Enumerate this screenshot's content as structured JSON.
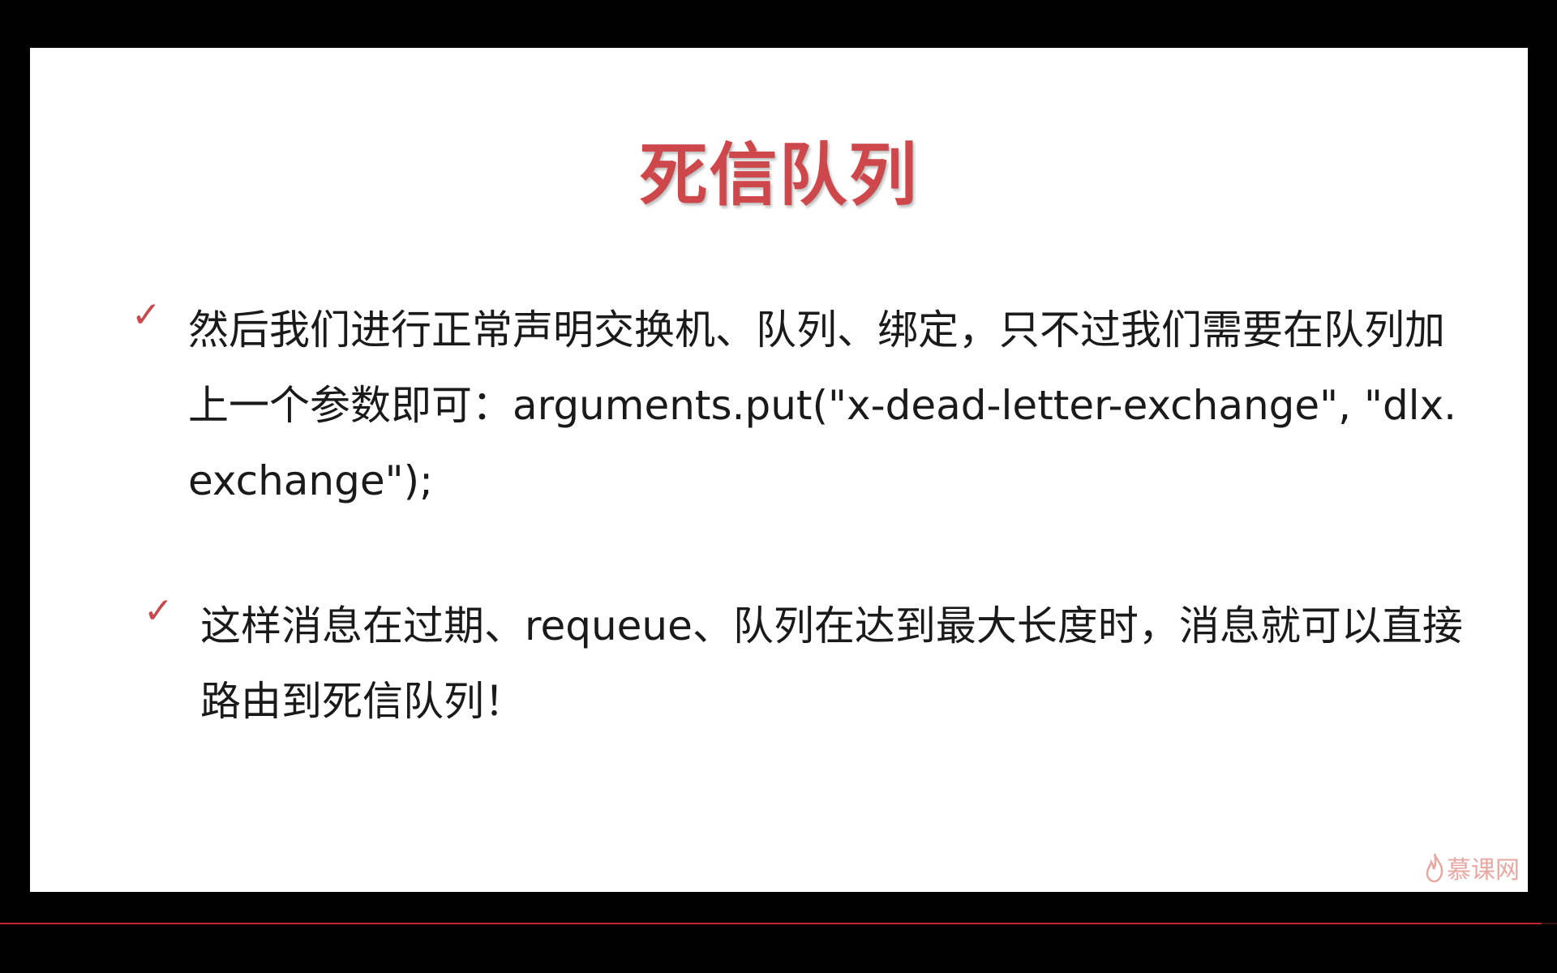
{
  "slide": {
    "title": "死信队列",
    "bullets": [
      {
        "icon": "checkmark-icon",
        "text": "然后我们进行正常声明交换机、队列、绑定，只不过我们需要在队列加上一个参数即可：arguments.put(\"x-dead-letter-exchange\", \"dlx.exchange\");"
      },
      {
        "icon": "checkmark-icon",
        "text": "这样消息在过期、requeue、队列在达到最大长度时，消息就可以直接路由到死信队列！"
      }
    ],
    "check_symbol": "✓",
    "watermark": "慕课网"
  },
  "player": {
    "progress": 0.99
  },
  "colors": {
    "title": "#cd474b",
    "check": "#c94a4e",
    "text": "#1a1a1a",
    "watermark": "#e9a7a2",
    "progress": "#c2262c"
  }
}
